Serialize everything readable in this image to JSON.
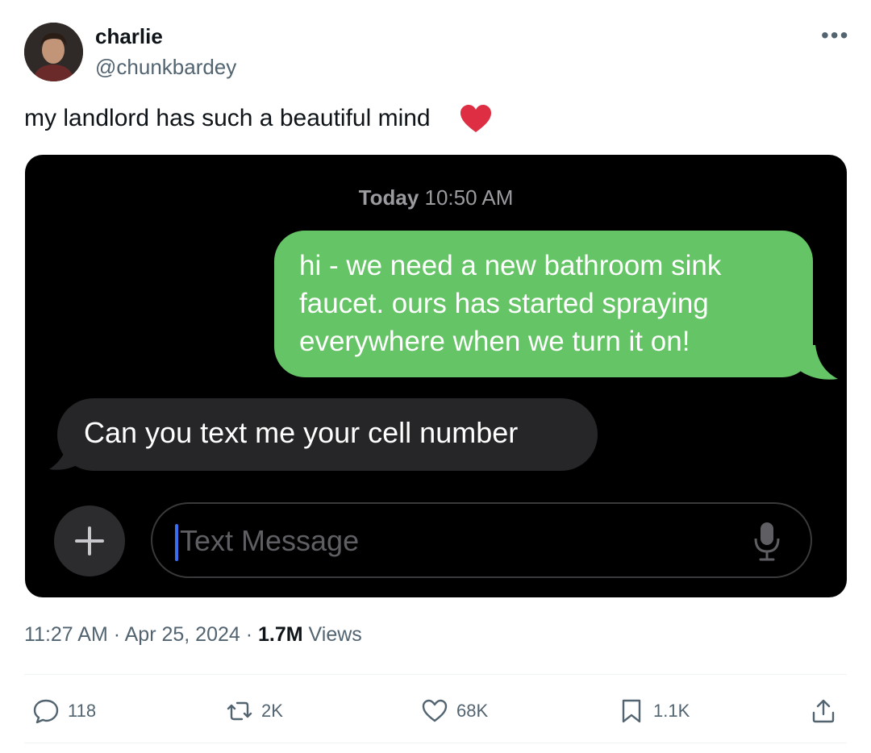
{
  "tweet": {
    "display_name": "charlie",
    "handle": "@chunkbardey",
    "more_icon": "•••",
    "text": "my landlord has such a beautiful mind",
    "emoji": "red-heart",
    "meta": {
      "time": "11:27 AM",
      "separator1": " · ",
      "date": "Apr 25, 2024",
      "separator2": " · ",
      "views_count": "1.7M",
      "views_label": " Views"
    },
    "actions": {
      "replies": "118",
      "reposts": "2K",
      "likes": "68K",
      "bookmarks": "1.1K"
    }
  },
  "screenshot": {
    "timestamp_day": "Today",
    "timestamp_time": " 10:50 AM",
    "outgoing_message": "hi - we need a new bathroom sink faucet. ours has started spraying everywhere when we turn it on!",
    "incoming_message": "Can you text me your cell number",
    "input_placeholder": "Text Message",
    "colors": {
      "outgoing_bubble": "#65c466",
      "incoming_bubble": "#262628",
      "background": "#000000"
    }
  }
}
